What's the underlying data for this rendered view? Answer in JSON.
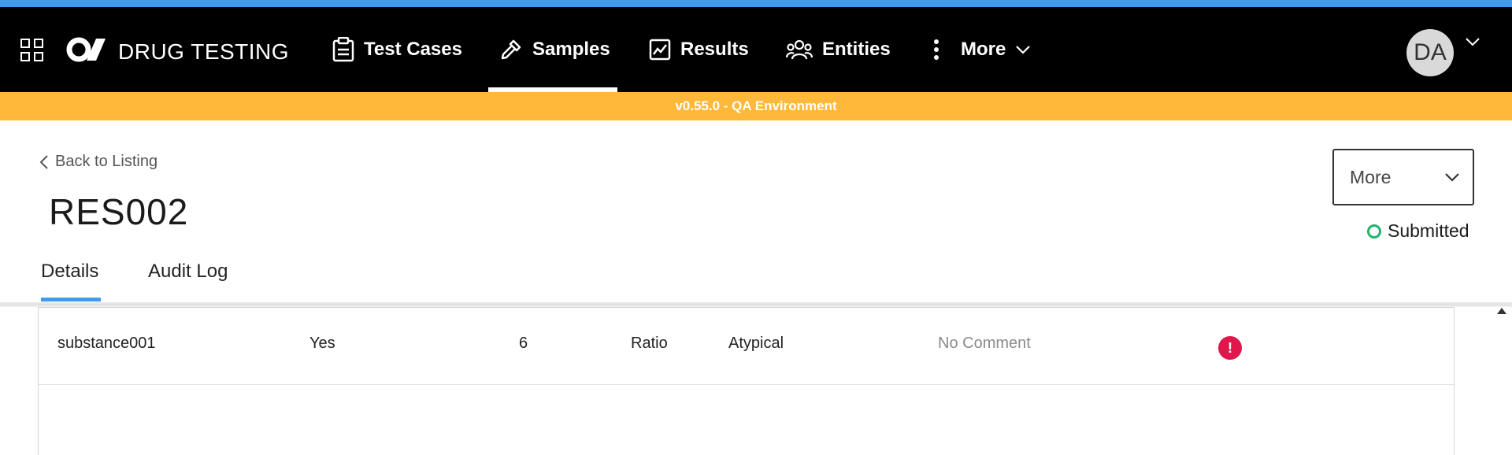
{
  "app": {
    "brand": "DRUG TESTING",
    "accent_color": "#3f9bf0",
    "nav_background": "#000000"
  },
  "nav": {
    "items": [
      {
        "label": "Test Cases",
        "icon": "clipboard-icon"
      },
      {
        "label": "Samples",
        "icon": "pipette-icon",
        "active": true
      },
      {
        "label": "Results",
        "icon": "chart-line-icon"
      },
      {
        "label": "Entities",
        "icon": "users-icon"
      },
      {
        "label": "More",
        "icon": "kebab-icon"
      }
    ]
  },
  "user": {
    "initials": "DA"
  },
  "environment": {
    "label": "v0.55.0 - QA Environment",
    "color": "#ffb83a"
  },
  "page": {
    "back_label": "Back to Listing",
    "title": "RES002",
    "more_label": "More",
    "status": "Submitted",
    "status_color": "#21b26b"
  },
  "tabs": {
    "items": [
      {
        "label": "Details",
        "active": true
      },
      {
        "label": "Audit Log"
      }
    ]
  },
  "table": {
    "rows": [
      {
        "substance": "substance001",
        "flag": "Yes",
        "value": "6",
        "type": "Ratio",
        "result": "Atypical",
        "comment": "No Comment",
        "alert_icon": "!"
      }
    ]
  }
}
